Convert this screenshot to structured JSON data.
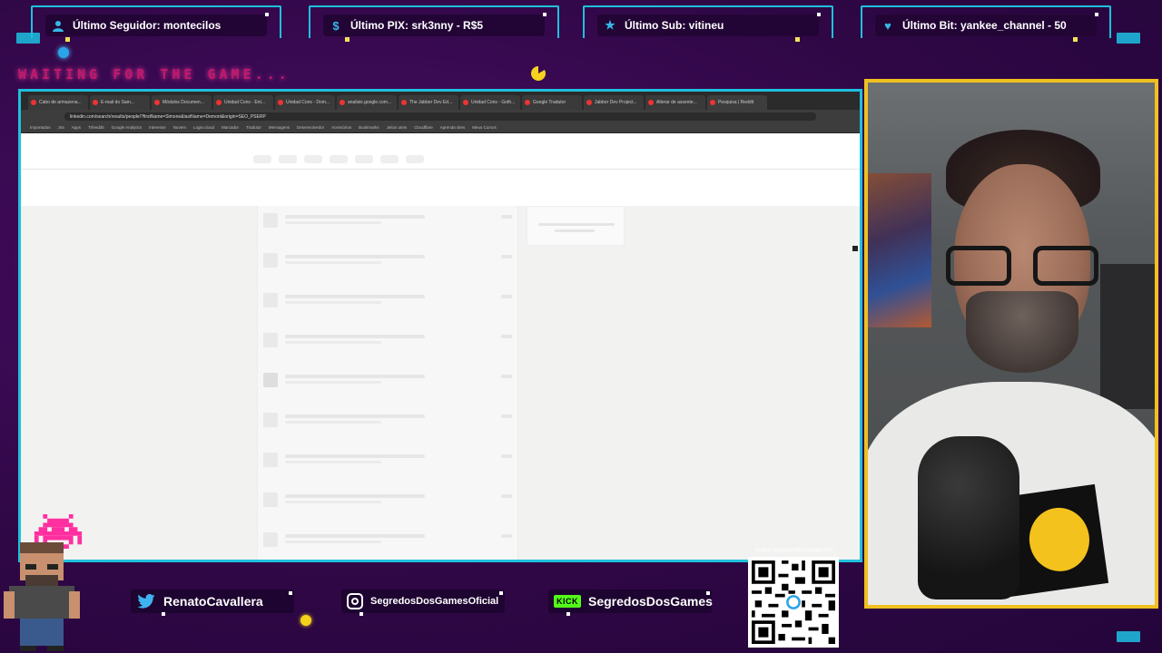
{
  "banners": [
    {
      "label": "Último Seguidor: montecilos",
      "icon": "user-icon"
    },
    {
      "label": "Último PIX: srk3nny - R$5",
      "icon": "dollar-icon"
    },
    {
      "label": "Último Sub: vitineu",
      "icon": "star-icon"
    },
    {
      "label": "Último Bit: yankee_channel - 50",
      "icon": "heart-icon"
    }
  ],
  "waiting_text": "WAITING FOR THE GAME...",
  "browser": {
    "tabs": [
      "Cabo de armazena...",
      "E-mail do Sam...",
      "Módulos Documen...",
      "Unidad Cons - Ent...",
      "Unidad Cons - Dom...",
      "analisis.google.com...",
      "The Jabber Dev Ed...",
      "Unidad Cons - Goth...",
      "Google Tradutor",
      "Jabber Dev Project...",
      "Alterar de assente...",
      "Pesquisa | Reddit"
    ],
    "address": "linkedin.com/search/results/people/?firstName=Simone&lastName=Demont&origin=SEO_PSERP",
    "bookmarks": [
      "Importados",
      "Jira",
      "Apps",
      "Trfeeddit",
      "Google Analytics",
      "Interesse",
      "Nuvem",
      "Login.cloud",
      "Marcador",
      "Tradutor",
      "Mensagens",
      "Desenvolvedor",
      "Acessórios",
      "Bookmarks",
      "Jeitos uteis",
      "Cloudflare",
      "Aprenda sites",
      "Meus Cursos"
    ]
  },
  "socials": [
    {
      "label": "RenatoCavallera",
      "icon": "twitter-icon"
    },
    {
      "label": "SegredosDosGamesOficial",
      "icon": "instagram-icon"
    },
    {
      "label": "SegredosDosGames",
      "icon": "kick-icon",
      "icon_text": "KICK"
    }
  ],
  "qr": {
    "label": "livepix.gg/segredosdosgames"
  },
  "colors": {
    "accent": "#1fc0dc",
    "webcam_border": "#f0c020",
    "pink_text": "#c2186b"
  }
}
